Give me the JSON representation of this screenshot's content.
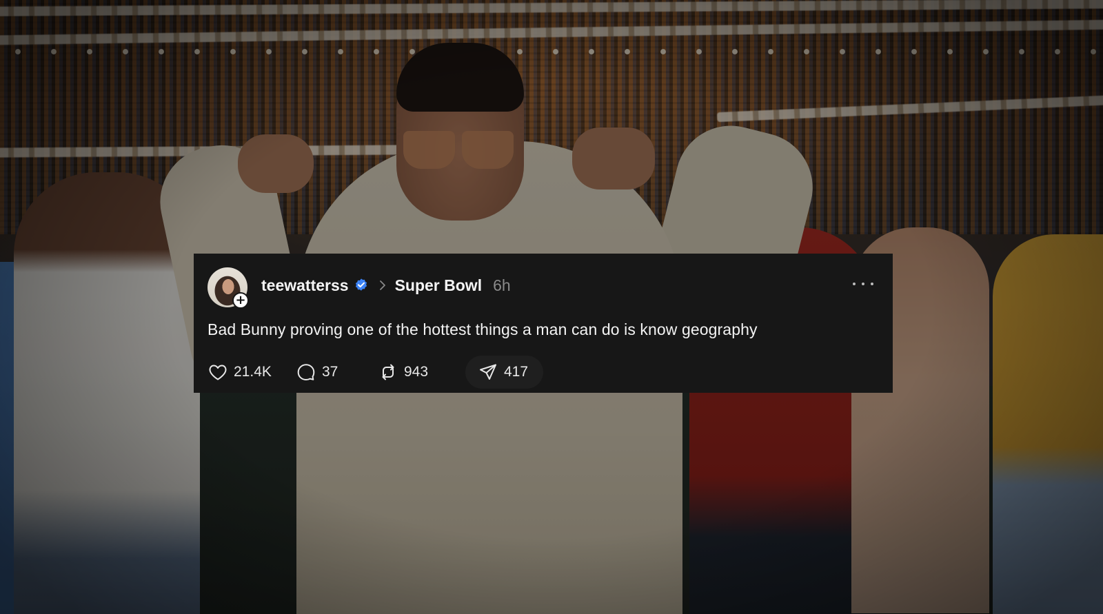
{
  "background": {
    "description_icon": "concert-photo"
  },
  "post": {
    "username": "teewatterss",
    "verified": true,
    "community": "Super Bowl",
    "time": "6h",
    "text": "Bad Bunny proving one of the hottest things a man can do is know geography",
    "actions": {
      "likes": "21.4K",
      "replies": "37",
      "reposts": "943",
      "shares": "417"
    },
    "icons": {
      "avatar_badge": "plus-icon",
      "verified": "verified-badge-icon",
      "breadcrumb": "chevron-right-icon",
      "more": "more-icon",
      "like": "heart-icon",
      "reply": "comment-icon",
      "repost": "repost-icon",
      "share": "send-icon"
    },
    "colors": {
      "card_bg": "#171717",
      "verified": "#3b82f6",
      "time": "#8a8a8a"
    }
  }
}
